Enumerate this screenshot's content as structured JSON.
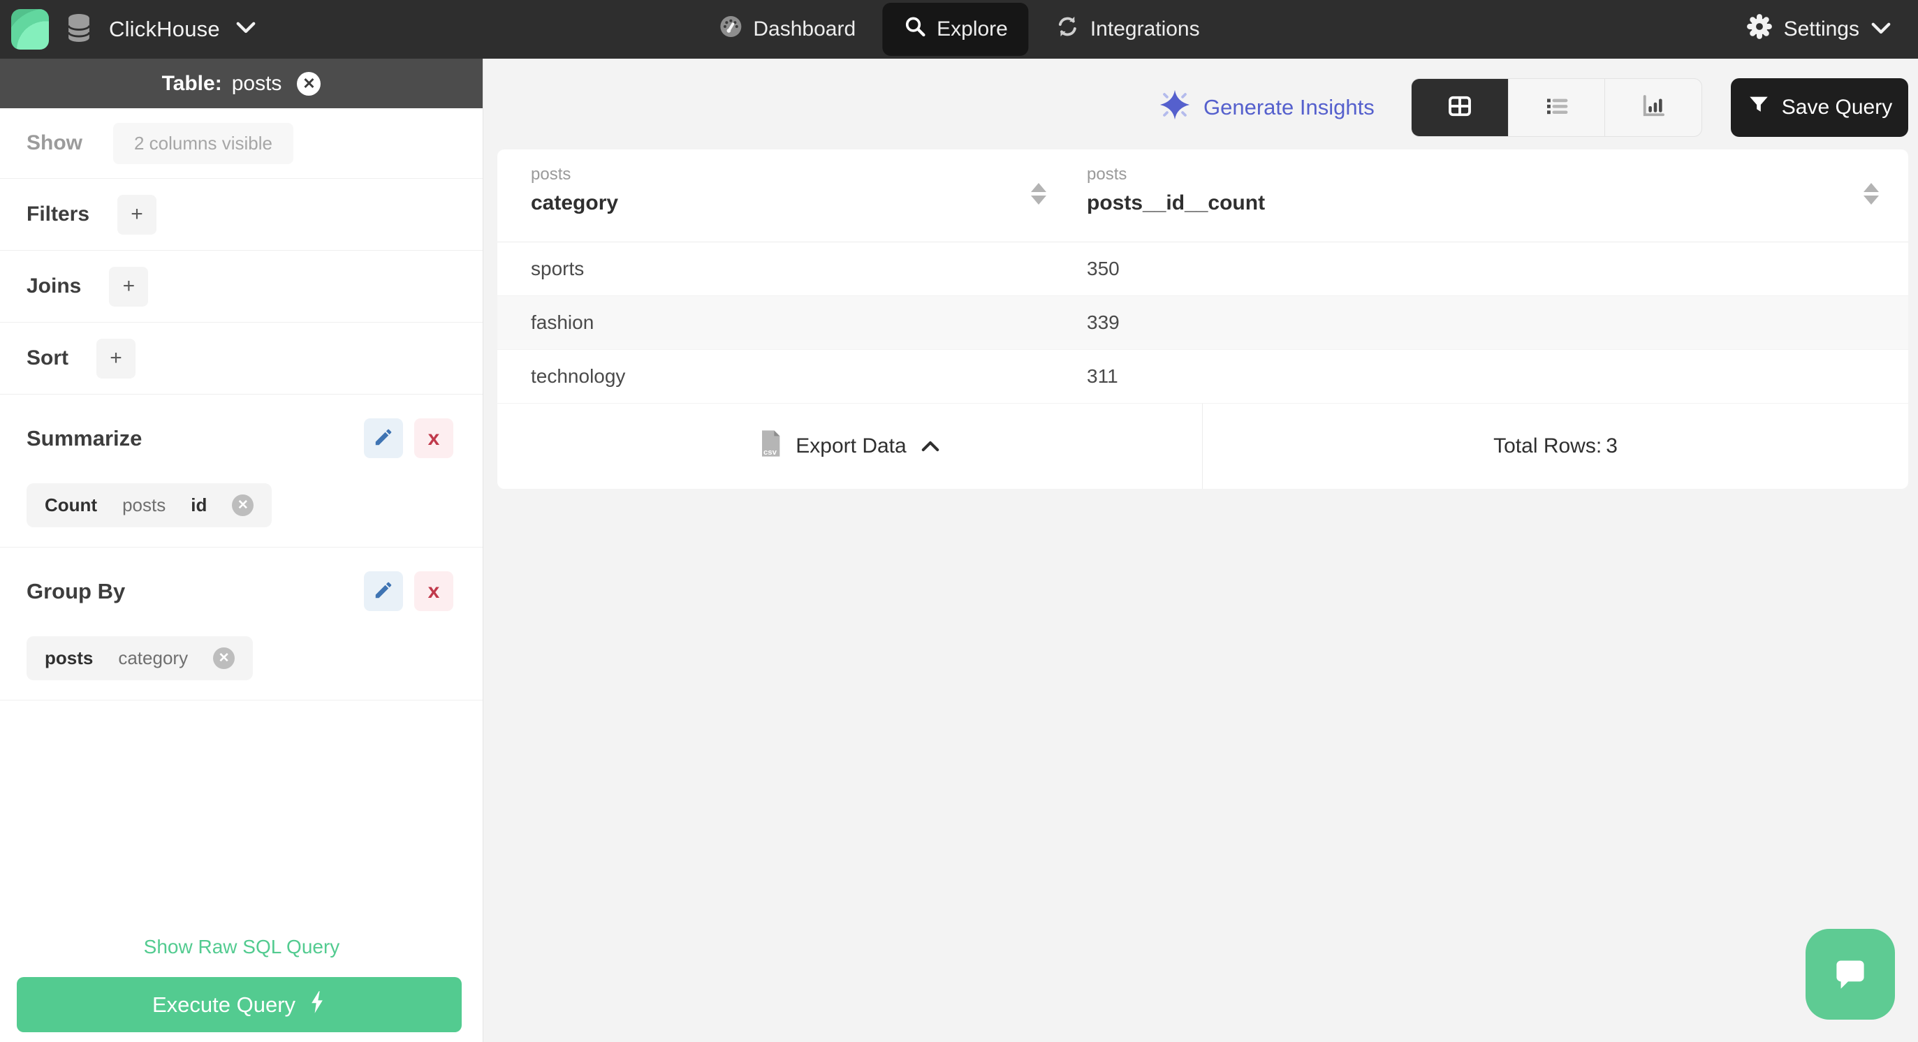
{
  "navbar": {
    "brand": "ClickHouse",
    "nav_items": [
      {
        "id": "dashboard",
        "label": "Dashboard",
        "icon": "gauge-icon",
        "active": false
      },
      {
        "id": "explore",
        "label": "Explore",
        "icon": "search-icon",
        "active": true
      },
      {
        "id": "integrations",
        "label": "Integrations",
        "icon": "sync-icon",
        "active": false
      }
    ],
    "settings_label": "Settings"
  },
  "sidebar": {
    "table_header": {
      "label": "Table:",
      "name": "posts"
    },
    "show": {
      "label": "Show",
      "value": "2 columns visible"
    },
    "builders": [
      {
        "label": "Filters",
        "add": "+"
      },
      {
        "label": "Joins",
        "add": "+"
      },
      {
        "label": "Sort",
        "add": "+"
      }
    ],
    "summarize": {
      "label": "Summarize",
      "delete_symbol": "x",
      "chip": {
        "agg": "Count",
        "table": "posts",
        "column": "id",
        "remove_symbol": "✕"
      }
    },
    "group_by": {
      "label": "Group By",
      "delete_symbol": "x",
      "chip": {
        "table": "posts",
        "column": "category",
        "remove_symbol": "✕"
      }
    },
    "raw_sql_label": "Show Raw SQL Query",
    "execute_label": "Execute Query"
  },
  "toolbar": {
    "generate_insights_label": "Generate Insights",
    "save_query_label": "Save Query",
    "view_modes": [
      "table",
      "list",
      "chart"
    ],
    "active_view": "table"
  },
  "results": {
    "columns": [
      {
        "group": "posts",
        "name": "category"
      },
      {
        "group": "posts",
        "name": "posts__id__count"
      }
    ],
    "rows": [
      {
        "category": "sports",
        "count": "350"
      },
      {
        "category": "fashion",
        "count": "339"
      },
      {
        "category": "technology",
        "count": "311"
      }
    ],
    "export_label": "Export Data",
    "total_rows_label": "Total Rows:",
    "total_rows_value": "3"
  },
  "colors": {
    "green_accent": "#53cb90",
    "indigo_accent": "#5560cd",
    "navbar_bg": "#2e2e2e",
    "sidebar_header_bg": "#4c4c4c",
    "danger_red": "#c0394b",
    "edit_blue": "#3f74b3"
  }
}
